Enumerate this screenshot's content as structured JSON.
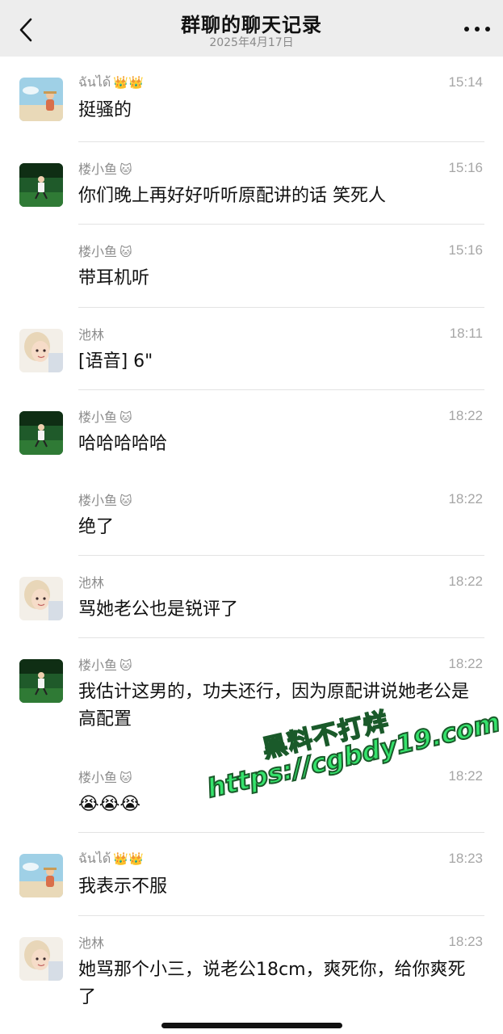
{
  "header": {
    "title": "群聊的聊天记录",
    "subtitle": "2025年4月17日",
    "back_icon": "chevron-left-icon",
    "more_icon": "more-dots-icon"
  },
  "messages": [
    {
      "sender": "ฉันได้",
      "badge": "👑👑",
      "time": "15:14",
      "text": "挺骚的",
      "avatar": "beach-photo-avatar"
    },
    {
      "sender": "楼小鱼",
      "badge": "🐱",
      "time": "15:16",
      "text": "你们晚上再好好听听原配讲的话 笑死人",
      "avatar": "green-field-avatar"
    },
    {
      "sender": "楼小鱼",
      "badge": "🐱",
      "time": "15:16",
      "text": "带耳机听",
      "avatar": ""
    },
    {
      "sender": "池林",
      "badge": "",
      "time": "18:11",
      "text": "[语音] 6\"",
      "avatar": "anime-girl-avatar"
    },
    {
      "sender": "楼小鱼",
      "badge": "🐱",
      "time": "18:22",
      "text": "哈哈哈哈哈",
      "avatar": "green-field-avatar"
    },
    {
      "sender": "楼小鱼",
      "badge": "🐱",
      "time": "18:22",
      "text": "绝了",
      "avatar": ""
    },
    {
      "sender": "池林",
      "badge": "",
      "time": "18:22",
      "text": "骂她老公也是锐评了",
      "avatar": "anime-girl-avatar"
    },
    {
      "sender": "楼小鱼",
      "badge": "🐱",
      "time": "18:22",
      "text": "我估计这男的，功夫还行，因为原配讲说她老公是高配置",
      "avatar": "green-field-avatar"
    },
    {
      "sender": "楼小鱼",
      "badge": "🐱",
      "time": "18:22",
      "text": "😭😭😭",
      "avatar": ""
    },
    {
      "sender": "ฉันได้",
      "badge": "👑👑",
      "time": "18:23",
      "text": "我表示不服",
      "avatar": "beach-photo-avatar"
    },
    {
      "sender": "池林",
      "badge": "",
      "time": "18:23",
      "text": "她骂那个小三，说老公18cm，爽死你，给你爽死了",
      "avatar": "anime-girl-avatar"
    }
  ],
  "watermark": {
    "line1": "黑料不打烊",
    "line2": "https://cgbdy19.com",
    "color": "#35e36c"
  },
  "colors": {
    "header_bg": "#ededed",
    "divider": "#e3e3e3",
    "name": "#8c8c8c",
    "time": "#a6a6a6"
  }
}
